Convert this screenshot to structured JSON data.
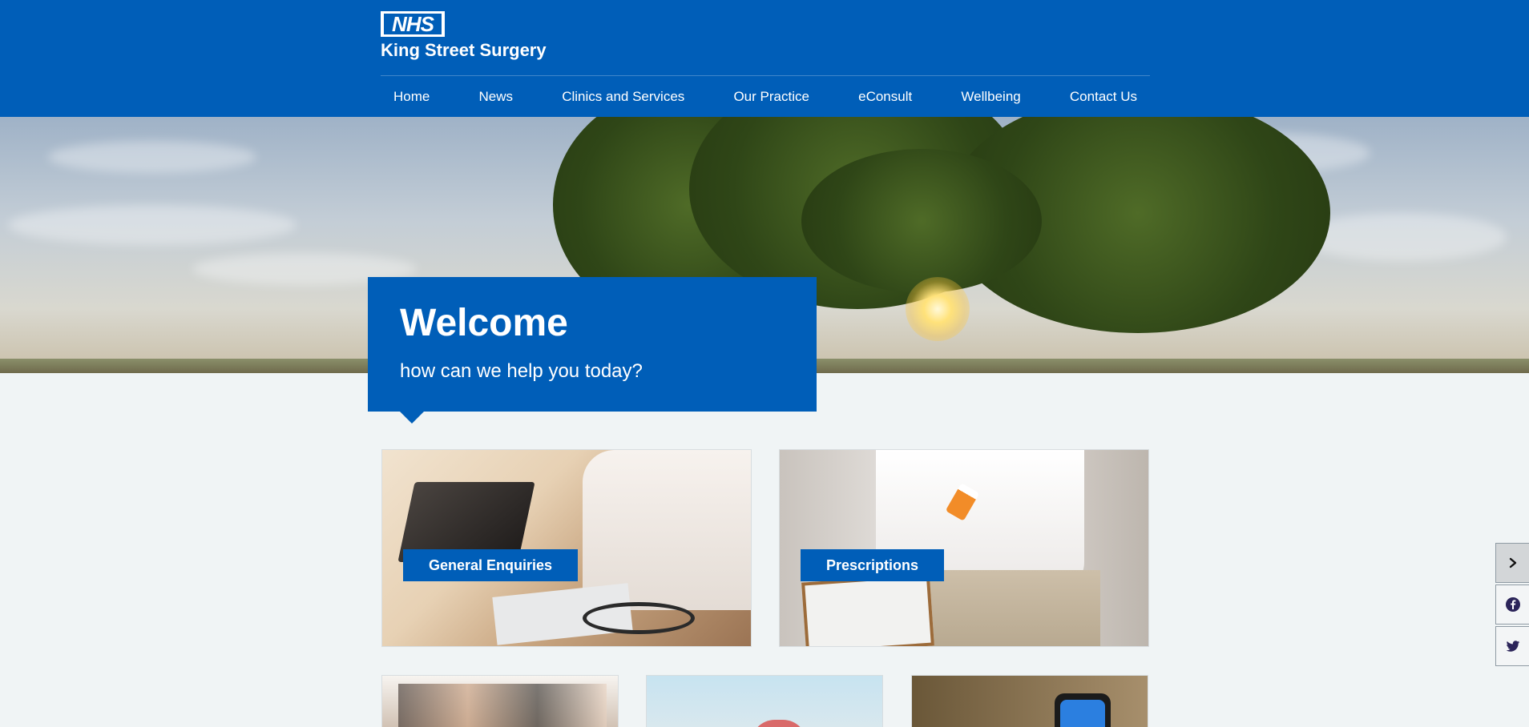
{
  "header": {
    "logo_text": "NHS",
    "practice_name": "King Street Surgery"
  },
  "nav": {
    "items": [
      {
        "label": "Home"
      },
      {
        "label": "News"
      },
      {
        "label": "Clinics and Services"
      },
      {
        "label": "Our Practice"
      },
      {
        "label": "eConsult"
      },
      {
        "label": "Wellbeing"
      },
      {
        "label": "Contact Us"
      }
    ]
  },
  "welcome": {
    "title": "Welcome",
    "subtitle": "how can we help you today?"
  },
  "cards": [
    {
      "label": "General Enquiries"
    },
    {
      "label": "Prescriptions"
    }
  ],
  "side_widgets": {
    "toggle_icon": "chevron-right-icon",
    "facebook_icon": "facebook-icon",
    "twitter_icon": "twitter-icon"
  },
  "colors": {
    "nhs_blue": "#005eb8",
    "page_background": "#f0f4f5",
    "white": "#ffffff"
  }
}
